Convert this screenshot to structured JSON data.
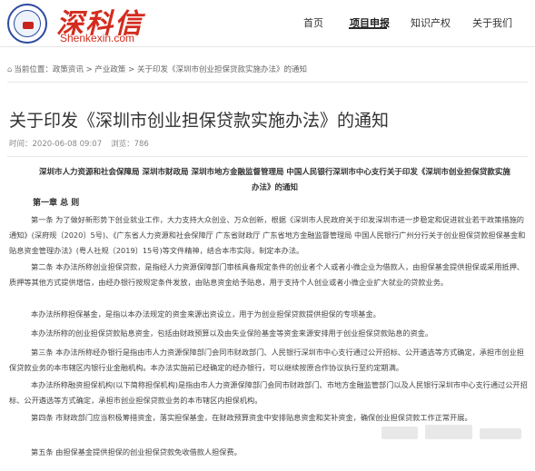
{
  "brand": {
    "name_cn": "深科信",
    "name_en": "Shenkexin.com",
    "seal_alt": "logo seal"
  },
  "nav": {
    "items": [
      {
        "label": "首页",
        "active": false
      },
      {
        "label": "项目申报",
        "active": true
      },
      {
        "label": "知识产权",
        "active": false
      },
      {
        "label": "关于我们",
        "active": false
      }
    ]
  },
  "breadcrumb": {
    "text": "当前位置：政策资讯 > 产业政策 > 关于印发《深圳市创业担保贷款实施办法》的通知"
  },
  "article": {
    "title": "关于印发《深圳市创业担保贷款实施办法》的通知",
    "time": "时间：2020-06-08 09:07",
    "views": "浏览：786",
    "issuers": "深圳市人力资源和社会保障局 深圳市财政局 深圳市地方金融监督管理局 中国人民银行深圳市中心支行关于印发《深圳市创业担保贷款实施办法》的通知",
    "chapter": "第一章 总 则",
    "paragraphs": [
      "第一条 为了做好新形势下创业就业工作，大力支持大众创业、万众创新，根据《深圳市人民政府关于印发深圳市进一步稳定和促进就业若干政策措施的通知》(深府规〔2020〕5号)、《广东省人力资源和社会保障厅 广东省财政厅 广东省地方金融监督管理局 中国人民银行广州分行关于创业担保贷款担保基金和贴息资金管理办法》(粤人社规〔2019〕15号)等文件精神，结合本市实际，制定本办法。",
      "第二条 本办法所称创业担保贷款，是指经人力资源保障部门审核具备规定条件的创业者个人或者小微企业为借款人，由担保基金提供担保或采用抵押、质押等其他方式提供增信，由经办银行按规定条件发放，由贴息资金给予贴息，用于支持个人创业或者小微企业扩大就业的贷款业务。",
      "本办法所称担保基金，是指以本办法规定的资金来源出资设立，用于为创业担保贷款提供担保的专项基金。",
      "本办法所称的创业担保贷款贴息资金，包括由财政预算以及由失业保险基金等资金来源安排用于创业担保贷款贴息的资金。",
      "第三条 本办法所称经办银行是指由市人力资源保障部门会同市财政部门、人民银行深圳市中心支行通过公开招标、公开遴选等方式确定，承担市创业担保贷款业务的本市辖区内银行业金融机构。本办法实施前已经确定的经办银行，可以继续按原合作协议执行至约定期满。",
      "本办法所称融资担保机构(以下简称担保机构)是指由市人力资源保障部门会同市财政部门、市地方金融监管部门以及人民银行深圳市中心支行通过公开招标、公开遴选等方式确定，承担市创业担保贷款业务的本市辖区内担保机构。",
      "第四条 市财政部门应当积极筹措资金，落实担保基金，在财政预算资金中安排贴息资金和奖补资金，确保创业担保贷款工作正常开展。",
      "第五条 由担保基金提供担保的创业担保贷款免收借款人担保费。"
    ]
  }
}
